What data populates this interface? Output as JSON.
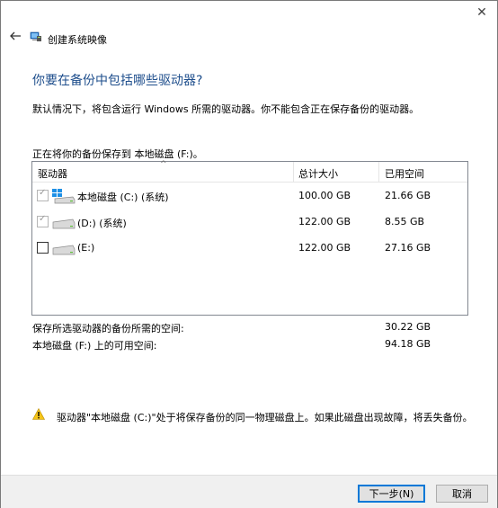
{
  "window": {
    "close_glyph": "✕"
  },
  "header": {
    "title": "创建系统映像",
    "back_icon": "arrow-left-icon",
    "app_icon": "system-image-icon"
  },
  "main": {
    "heading": "你要在备份中包括哪些驱动器?",
    "description": "默认情况下，将包含运行 Windows 所需的驱动器。你不能包含正在保存备份的驱动器。",
    "save_location": "正在将你的备份保存到 本地磁盘 (F:)。"
  },
  "table": {
    "columns": [
      "驱动器",
      "总计大小",
      "已用空间"
    ],
    "sort_glyph": "^",
    "rows": [
      {
        "name": "本地磁盘 (C:) (系统)",
        "total": "100.00 GB",
        "used": "21.66 GB",
        "checked": true,
        "disabled": true,
        "icon": "windows-drive-icon"
      },
      {
        "name": "(D:) (系统)",
        "total": "122.00 GB",
        "used": "8.55 GB",
        "checked": true,
        "disabled": true,
        "icon": "drive-icon"
      },
      {
        "name": "(E:)",
        "total": "122.00 GB",
        "used": "27.16 GB",
        "checked": false,
        "disabled": false,
        "icon": "drive-icon"
      }
    ]
  },
  "summary": {
    "required_label": "保存所选驱动器的备份所需的空间:",
    "required_value": "30.22 GB",
    "available_label": "本地磁盘 (F:) 上的可用空间:",
    "available_value": "94.18 GB"
  },
  "warning": {
    "icon": "warning-icon",
    "text": "驱动器\"本地磁盘 (C:)\"处于将保存备份的同一物理磁盘上。如果此磁盘出现故障，将丢失备份。"
  },
  "footer": {
    "next_label": "下一步(N)",
    "cancel_label": "取消"
  }
}
